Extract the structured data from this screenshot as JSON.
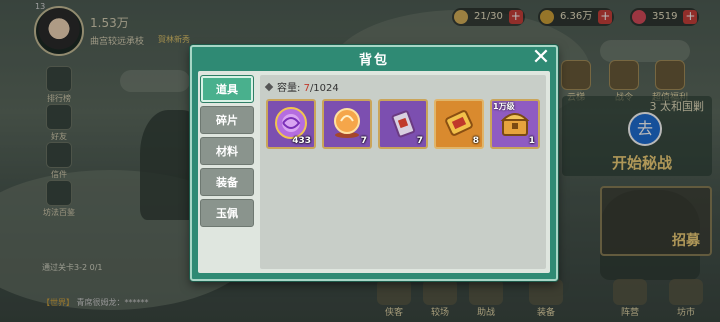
{
  "top": {
    "level": "13",
    "power": "1.53万",
    "player_title": "曲宫较远承枝",
    "tag": "賀林新秀",
    "resources": [
      {
        "name": "stamina",
        "value": "21/30",
        "icon": "bun-icon",
        "color": "#d9b25a"
      },
      {
        "name": "coins",
        "value": "6.36万",
        "icon": "coin-icon",
        "color": "#d0a33a"
      },
      {
        "name": "gems",
        "value": "3519",
        "icon": "gem-icon",
        "color": "#d94b5b"
      }
    ]
  },
  "left_menu": [
    {
      "label": "排行榜",
      "icon": "ranking-icon"
    },
    {
      "label": "好友",
      "icon": "friends-icon"
    },
    {
      "label": "信件",
      "icon": "mail-icon"
    },
    {
      "label": "坊法百鉴",
      "icon": "book-icon"
    }
  ],
  "right_menu": [
    {
      "label": "云梯",
      "icon": "ladder-icon"
    },
    {
      "label": "战令",
      "icon": "battle-pass-icon"
    },
    {
      "label": "超值福利",
      "icon": "welfare-icon"
    }
  ],
  "stage": {
    "title": "3 太和国剿",
    "action": "开始秘战",
    "recruit": "招募"
  },
  "dialog": {
    "title": "背包",
    "tabs": [
      "道具",
      "碎片",
      "材料",
      "装备",
      "玉佩"
    ],
    "active_tab": 0,
    "capacity_label": "容量:",
    "capacity_current": "7",
    "capacity_max": "/1024",
    "items": [
      {
        "icon": "purple-orb-icon",
        "count": "433",
        "bg": "#7c4fb0"
      },
      {
        "icon": "golden-sphere-icon",
        "count": "7",
        "bg": "#7c4fb0"
      },
      {
        "icon": "token-tag-icon",
        "count": "7",
        "bg": "#7c4fb0"
      },
      {
        "icon": "gold-scroll-icon",
        "count": "8",
        "bg": "#d98a2e"
      },
      {
        "icon": "treasure-chest-icon",
        "count": "1",
        "bg": "#8f5bc2",
        "tag": "1万级"
      }
    ]
  },
  "quest": "通过关卡3-2 0/1",
  "chat": {
    "channel": "【世界】",
    "text": "青席很姆龙：******"
  },
  "bottom_menu": [
    "侠客",
    "较场",
    "助战",
    "装备",
    "阵营",
    "坊市"
  ]
}
